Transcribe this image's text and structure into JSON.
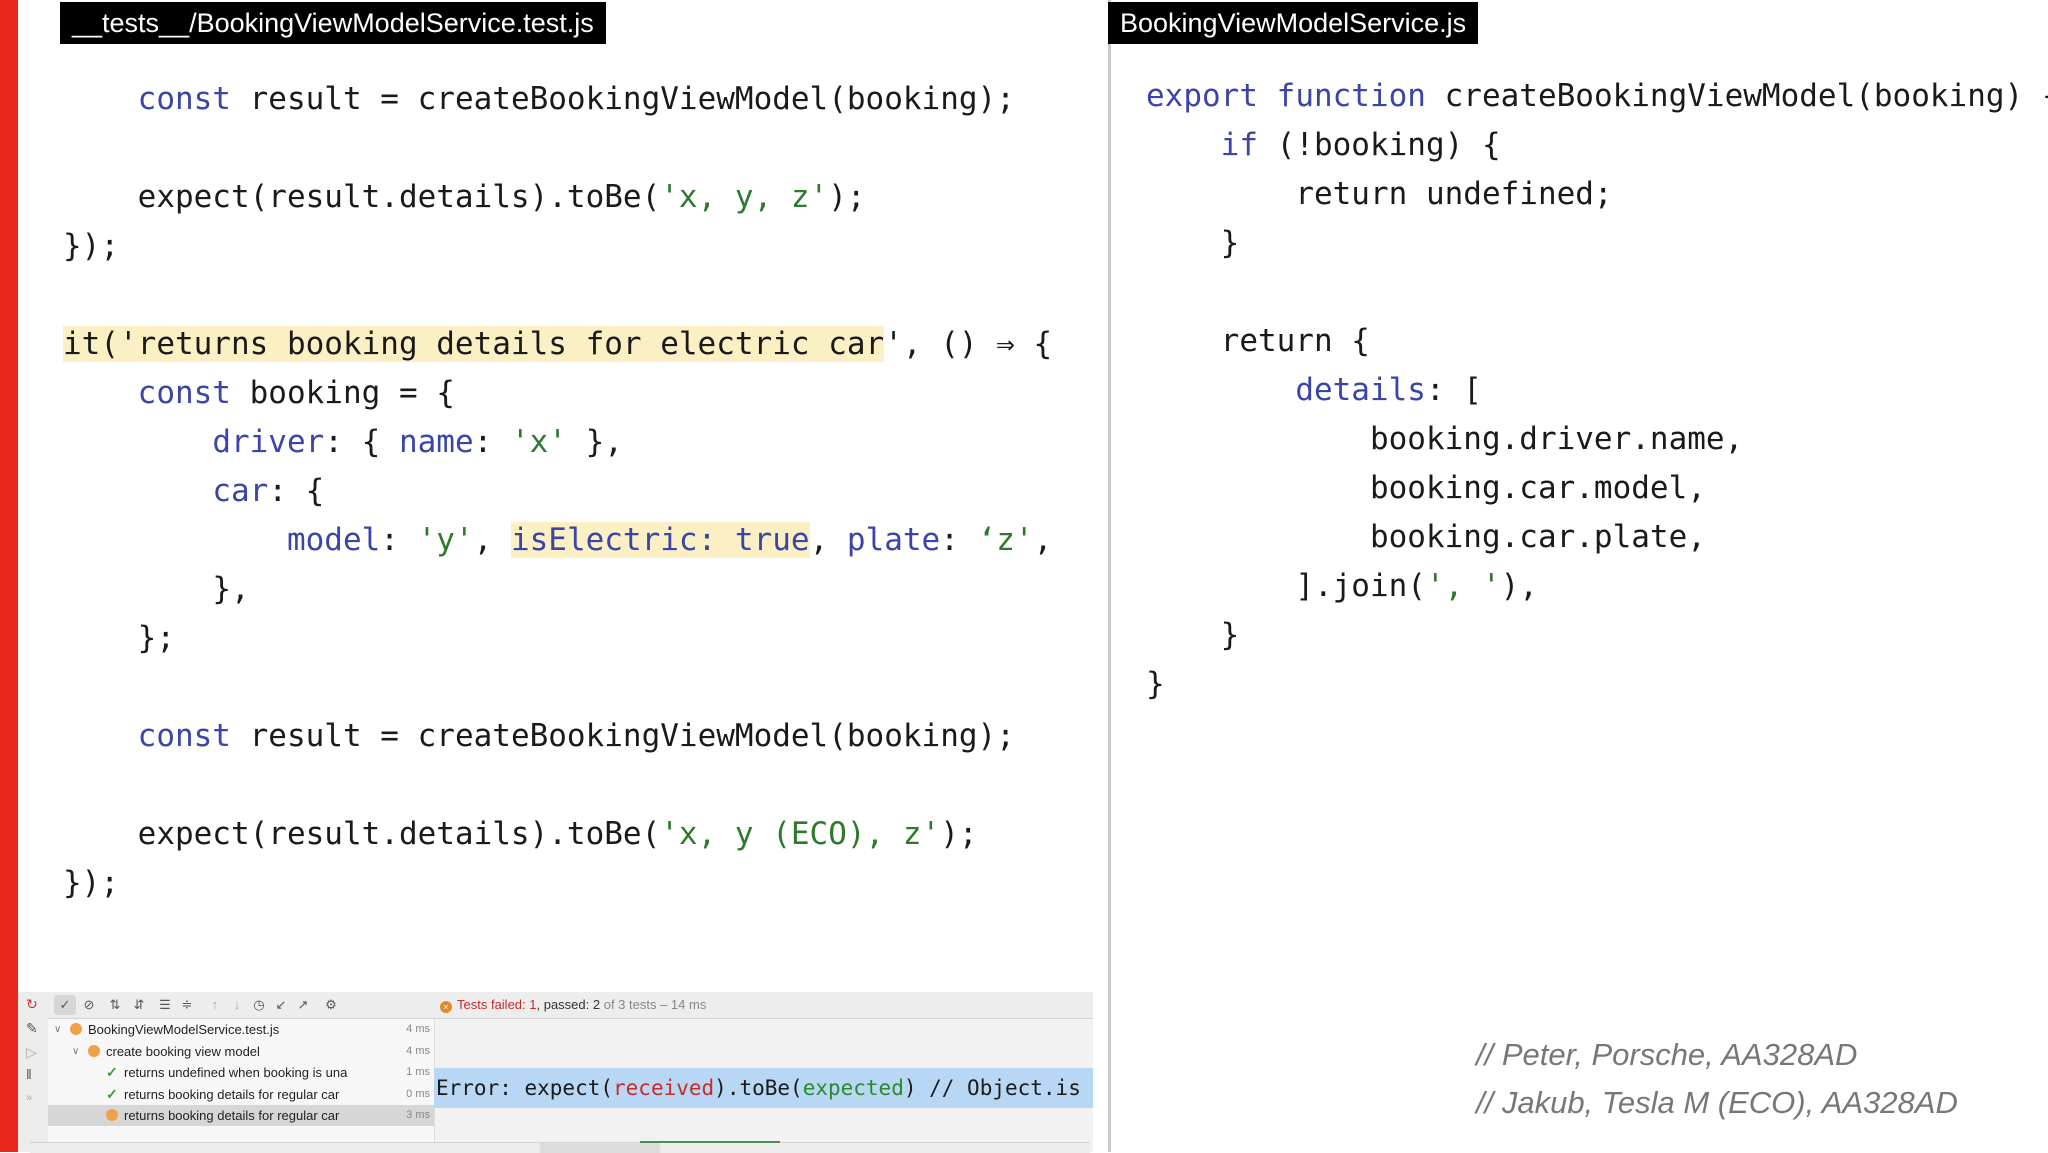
{
  "left": {
    "tab_title": "__tests__/BookingViewModelService.test.js",
    "lines": [
      {
        "indent": "    ",
        "tokens": [
          {
            "t": "const",
            "c": "kw"
          },
          {
            "t": " result = createBookingViewModel(booking);"
          }
        ]
      },
      {
        "indent": "",
        "tokens": []
      },
      {
        "indent": "    ",
        "tokens": [
          {
            "t": "expect(result.details).toBe("
          },
          {
            "t": "'x, y, z'",
            "c": "str"
          },
          {
            "t": ");"
          }
        ]
      },
      {
        "indent": "",
        "tokens": [
          {
            "t": "});"
          }
        ]
      },
      {
        "indent": "",
        "tokens": []
      },
      {
        "indent": "",
        "tokens": [
          {
            "t": "it('returns booking details for electric car",
            "c": "hl"
          },
          {
            "t": "', () ⇒ {"
          }
        ]
      },
      {
        "indent": "    ",
        "tokens": [
          {
            "t": "const",
            "c": "kw"
          },
          {
            "t": " booking = {"
          }
        ]
      },
      {
        "indent": "        ",
        "tokens": [
          {
            "t": "driver",
            "c": "kw"
          },
          {
            "t": ": { "
          },
          {
            "t": "name",
            "c": "kw"
          },
          {
            "t": ": "
          },
          {
            "t": "'x'",
            "c": "str"
          },
          {
            "t": " },"
          }
        ]
      },
      {
        "indent": "        ",
        "tokens": [
          {
            "t": "car",
            "c": "kw"
          },
          {
            "t": ": {"
          }
        ]
      },
      {
        "indent": "            ",
        "tokens": [
          {
            "t": "model",
            "c": "kw"
          },
          {
            "t": ": "
          },
          {
            "t": "'y'",
            "c": "str"
          },
          {
            "t": ", "
          },
          {
            "t": "isElectric: true",
            "c": "kw hl"
          },
          {
            "t": ", "
          },
          {
            "t": "plate",
            "c": "kw"
          },
          {
            "t": ": "
          },
          {
            "t": "‘z'",
            "c": "str"
          },
          {
            "t": ","
          }
        ]
      },
      {
        "indent": "        ",
        "tokens": [
          {
            "t": "},"
          }
        ]
      },
      {
        "indent": "    ",
        "tokens": [
          {
            "t": "};"
          }
        ]
      },
      {
        "indent": "",
        "tokens": []
      },
      {
        "indent": "    ",
        "tokens": [
          {
            "t": "const",
            "c": "kw"
          },
          {
            "t": " result = createBookingViewModel(booking);"
          }
        ]
      },
      {
        "indent": "",
        "tokens": []
      },
      {
        "indent": "    ",
        "tokens": [
          {
            "t": "expect(result.details).toBe("
          },
          {
            "t": "'x, y (ECO), z'",
            "c": "str"
          },
          {
            "t": ");"
          }
        ]
      },
      {
        "indent": "",
        "tokens": [
          {
            "t": "});"
          }
        ]
      }
    ]
  },
  "right": {
    "tab_title": "BookingViewModelService.js",
    "lines": [
      {
        "indent": "",
        "tokens": [
          {
            "t": "export",
            "c": "kw"
          },
          {
            "t": " "
          },
          {
            "t": "function",
            "c": "kw"
          },
          {
            "t": " createBookingViewModel(booking) {"
          }
        ]
      },
      {
        "indent": "    ",
        "tokens": [
          {
            "t": "if",
            "c": "kw"
          },
          {
            "t": " (!booking) {"
          }
        ]
      },
      {
        "indent": "        ",
        "tokens": [
          {
            "t": "return undefined;"
          }
        ]
      },
      {
        "indent": "    ",
        "tokens": [
          {
            "t": "}"
          }
        ]
      },
      {
        "indent": "",
        "tokens": []
      },
      {
        "indent": "    ",
        "tokens": [
          {
            "t": "return {"
          }
        ]
      },
      {
        "indent": "        ",
        "tokens": [
          {
            "t": "details",
            "c": "kw"
          },
          {
            "t": ": ["
          }
        ]
      },
      {
        "indent": "            ",
        "tokens": [
          {
            "t": "booking.driver.name,"
          }
        ]
      },
      {
        "indent": "            ",
        "tokens": [
          {
            "t": "booking.car.model,"
          }
        ]
      },
      {
        "indent": "            ",
        "tokens": [
          {
            "t": "booking.car.plate,"
          }
        ]
      },
      {
        "indent": "        ",
        "tokens": [
          {
            "t": "].join("
          },
          {
            "t": "', '",
            "c": "str"
          },
          {
            "t": "),"
          }
        ]
      },
      {
        "indent": "    ",
        "tokens": [
          {
            "t": "}"
          }
        ]
      },
      {
        "indent": "",
        "tokens": [
          {
            "t": "}"
          }
        ]
      }
    ]
  },
  "test_panel": {
    "status": {
      "failed_label": "Tests failed: ",
      "failed_count": "1",
      "passed_label": ", passed: ",
      "passed_count": "2",
      "rest": " of 3 tests – 14 ms"
    },
    "tree": [
      {
        "depth": 0,
        "expand": "∨",
        "icon": "fail",
        "label": "BookingViewModelService.test.js",
        "duration": "4 ms",
        "selected": false
      },
      {
        "depth": 1,
        "expand": "∨",
        "icon": "fail",
        "label": "create booking view model",
        "duration": "4 ms",
        "selected": false
      },
      {
        "depth": 2,
        "expand": "",
        "icon": "pass",
        "label": "returns undefined when booking is una",
        "duration": "1 ms",
        "selected": false
      },
      {
        "depth": 2,
        "expand": "",
        "icon": "pass",
        "label": "returns booking details for regular car",
        "duration": "0 ms",
        "selected": false
      },
      {
        "depth": 2,
        "expand": "",
        "icon": "fail",
        "label": "returns booking details for regular car",
        "duration": "3 ms",
        "selected": true
      }
    ],
    "error": {
      "prefix": "Error: expect(",
      "received": "received",
      "mid": ").toBe(",
      "expected": "expected",
      "suffix": ") // Object.is"
    }
  },
  "comments": [
    "// Peter, Porsche, AA328AD",
    "// Jakub, Tesla M (ECO), AA328AD"
  ]
}
